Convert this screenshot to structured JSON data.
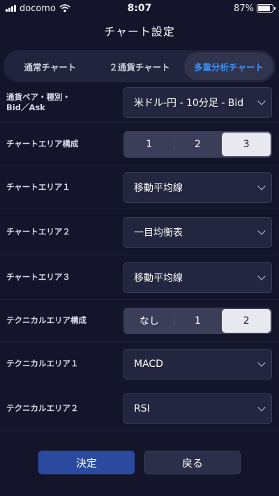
{
  "status_bar": {
    "carrier": "docomo",
    "time": "8:07",
    "battery": "87%",
    "battery_level": 0.87
  },
  "header": {
    "title": "チャート設定"
  },
  "tabs": [
    {
      "label": "通常チャート",
      "active": false
    },
    {
      "label": "２通貨チャート",
      "active": false
    },
    {
      "label": "多重分析チャート",
      "active": true
    }
  ],
  "settings": {
    "pair": {
      "label": "通貨ペア・種別・\nBid／Ask",
      "value": "米ドル-円 - 10分足 - Bid"
    },
    "chart_area_config": {
      "label": "チャートエリア構成",
      "options": [
        "1",
        "2",
        "3"
      ],
      "selected": "3"
    },
    "chart_area_1": {
      "label": "チャートエリア１",
      "value": "移動平均線"
    },
    "chart_area_2": {
      "label": "チャートエリア２",
      "value": "一目均衡表"
    },
    "chart_area_3": {
      "label": "チャートエリア３",
      "value": "移動平均線"
    },
    "tech_area_config": {
      "label": "テクニカルエリア構成",
      "options": [
        "なし",
        "1",
        "2"
      ],
      "selected": "2"
    },
    "tech_area_1": {
      "label": "テクニカルエリア１",
      "value": "MACD"
    },
    "tech_area_2": {
      "label": "テクニカルエリア２",
      "value": "RSI"
    }
  },
  "buttons": {
    "ok": "決定",
    "back": "戻る"
  },
  "colors": {
    "background": "#14152a",
    "accent": "#3d8ef0",
    "primary_button": "#2a4aa0"
  }
}
